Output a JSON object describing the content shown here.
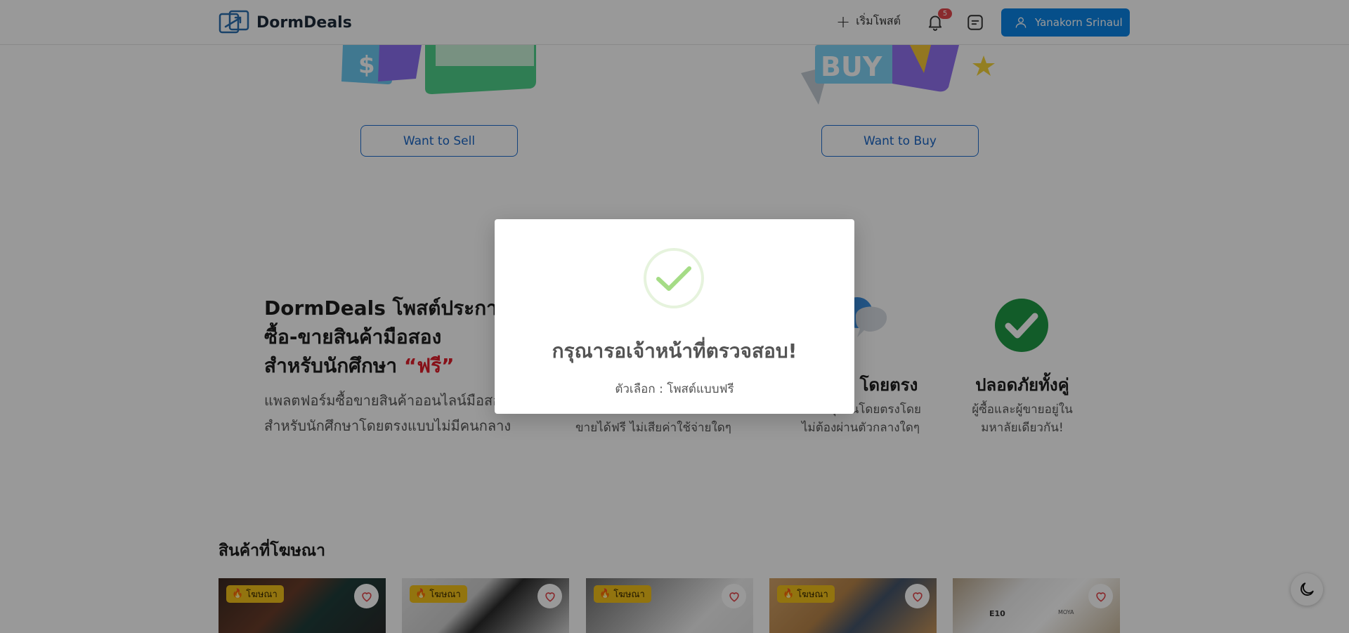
{
  "header": {
    "logo_text": "DormDeals",
    "start_post_label": "เริ่มโพสต์",
    "notification_count": "5",
    "user_name": "Yanakorn Srinaul"
  },
  "hero": {
    "want_to_sell": "Want to Sell",
    "want_to_buy": "Want to Buy",
    "buy_sign_text": "BUY"
  },
  "features": {
    "headline_line1": "DormDeals โพสต์ประกาศ",
    "headline_line2": "ซื้อ-ขายสินค้ามือสอง",
    "headline_line3_prefix": "สำหรับนักศึกษา ",
    "headline_free": "“ฟรี”",
    "subline_line1": "แพลตฟอร์มซื้อขายสินค้าออนไลน์มือสอ",
    "subline_line2": "สำหรับนักศึกษาโดยตรงแบบไม่มีคนกลาง",
    "feature2_desc": "ขายได้ฟรี ไม่เสียค่าใช้จ่ายใดๆ",
    "feature3_title": "โดยตรง",
    "feature3_desc_line1": "คุยกันโดยตรงโดย",
    "feature3_desc_line2": "ไม่ต้องผ่านตัวกลางใดๆ",
    "feature4_title": "ปลอดภัยทั้งคู่",
    "feature4_desc_line1": "ผู้ซื้อและผู้ขายอยู่ใน",
    "feature4_desc_line2": "มหาลัยเดียวกัน!"
  },
  "products": {
    "section_title": "สินค้าที่โฆษณา",
    "ad_badge": "โฆษณา",
    "e10_label": "E10",
    "moya_label": "MOYA"
  },
  "modal": {
    "title": "กรุณารอเจ้าหน้าที่ตรวจสอบ!",
    "subtitle": "ตัวเลือก : โพสต์แบบฟรี"
  },
  "colors": {
    "primary": "#0b84e6",
    "success": "#a5dc86",
    "free_red": "#e11d2a",
    "ad_yellow": "#f4c21a"
  }
}
